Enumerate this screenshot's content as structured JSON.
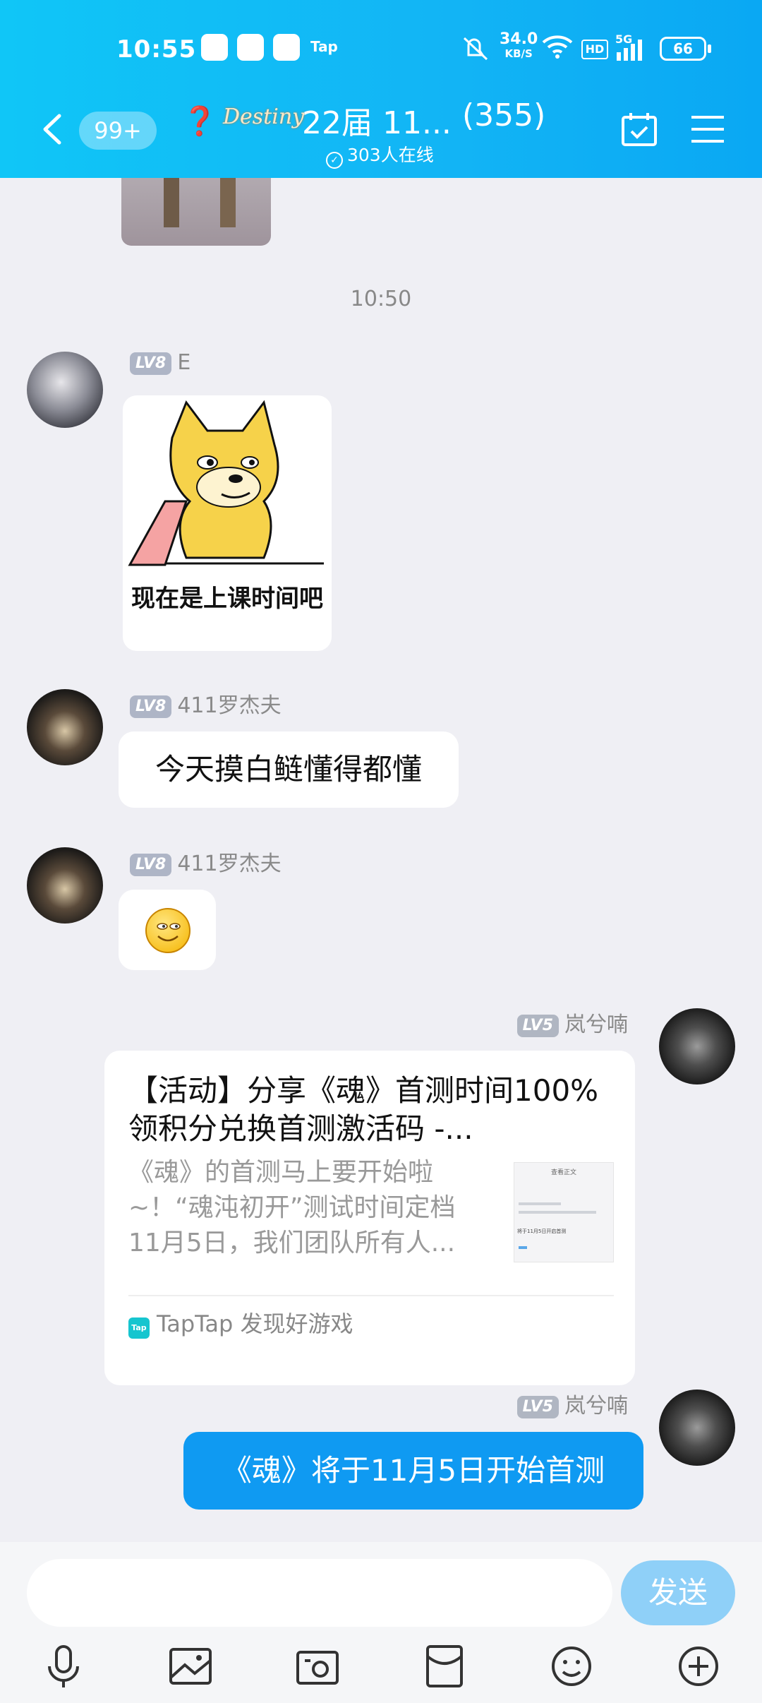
{
  "status_bar": {
    "time": "10:55",
    "net_speed": "34.0",
    "net_unit": "KB/S",
    "hd": "HD",
    "five_g": "5G",
    "battery": "66",
    "tap_label": "Tap"
  },
  "header": {
    "unread_badge": "99+",
    "group_logo": "Destiny",
    "group_title": "22届 11...",
    "member_count": "(355)",
    "online_text": "303人在线"
  },
  "chat": {
    "timestamp": "10:50",
    "messages": [
      {
        "level": "LV8",
        "name": "E",
        "sticker_caption": "现在是上课时间吧"
      },
      {
        "level": "LV8",
        "name": "411罗杰夫",
        "text": "今天摸白鲢懂得都懂"
      },
      {
        "level": "LV8",
        "name": "411罗杰夫",
        "emoji": "smile"
      },
      {
        "level": "LV5",
        "name": "岚兮喃",
        "card": {
          "title": "【活动】分享《魂》首测时间100%领积分兑换首测激活码 -...",
          "desc": "《魂》的首测马上要开始啦~！“魂沌初开”测试时间定档11月5日，我们团队所有人...",
          "source": "TapTap 发现好游戏",
          "source_icon": "Tap",
          "thumb_title": "查看正文",
          "thumb_line": "将于11月5日开启首测"
        }
      },
      {
        "level": "LV5",
        "name": "岚兮喃",
        "text": "《魂》将于11月5日开始首测"
      }
    ]
  },
  "composer": {
    "input_value": "",
    "send_label": "发送"
  },
  "colors": {
    "header_blue": "#12b4f5",
    "my_bubble": "#0f9af2",
    "send_button": "#8fd0f8"
  }
}
